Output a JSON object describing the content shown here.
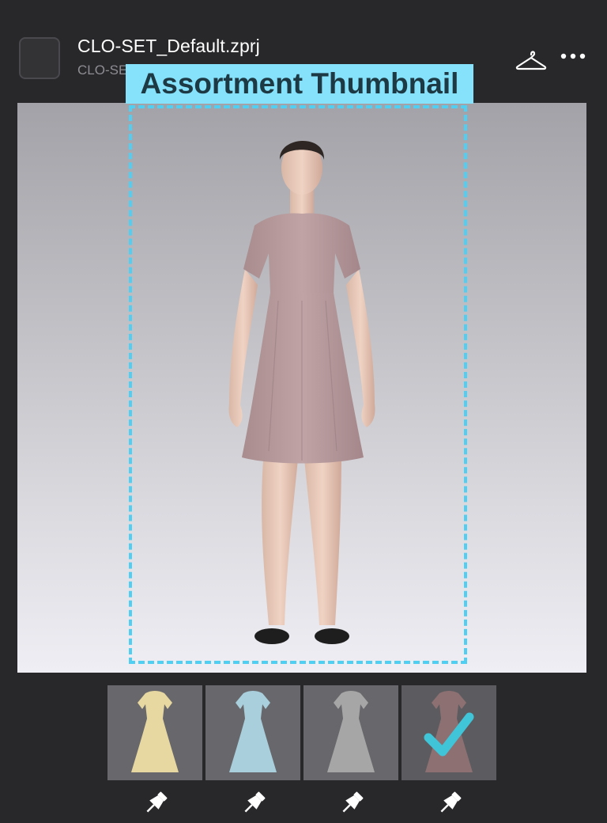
{
  "header": {
    "file_name": "CLO-SET_Default.zprj",
    "file_sub": "CLO-SET",
    "icons": [
      "hanger-icon",
      "more-icon"
    ]
  },
  "overlay": {
    "label": "Assortment Thumbnail",
    "color": "#86e1fb"
  },
  "viewport": {
    "background_top": "#a2a2a8",
    "background_bottom": "#eeeef4",
    "dress_color": "#b59c9c"
  },
  "colorways": [
    {
      "name": "yellow",
      "color": "#e7d7a0",
      "selected": false
    },
    {
      "name": "blue",
      "color": "#a9cfdc",
      "selected": false
    },
    {
      "name": "gray",
      "color": "#a6a6a6",
      "selected": false
    },
    {
      "name": "mauve",
      "color": "#8d7072",
      "selected": true
    }
  ],
  "accent": "#3fc4d8"
}
